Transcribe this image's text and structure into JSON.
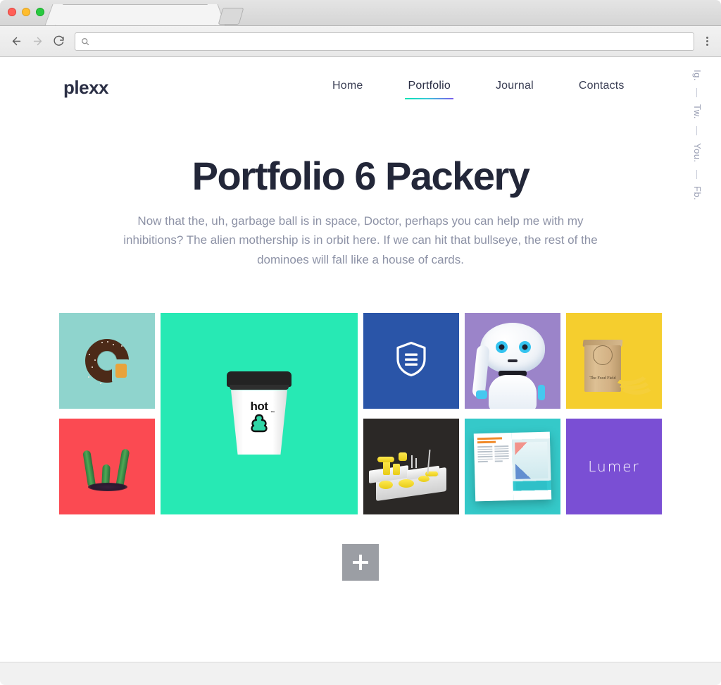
{
  "browser": {
    "tab_title": "",
    "url_value": "",
    "url_placeholder": "",
    "back_label": "Back",
    "forward_label": "Forward",
    "reload_label": "Reload",
    "menu_label": "Customize and control",
    "search_icon": "search-icon",
    "traffic_lights": [
      "close",
      "minimize",
      "maximize"
    ]
  },
  "site": {
    "logo": "plexx",
    "nav": [
      {
        "label": "Home",
        "active": false
      },
      {
        "label": "Portfolio",
        "active": true
      },
      {
        "label": "Journal",
        "active": false
      },
      {
        "label": "Contacts",
        "active": false
      }
    ],
    "social": [
      {
        "label": "Ig."
      },
      {
        "label": "—"
      },
      {
        "label": "Tw."
      },
      {
        "label": "—"
      },
      {
        "label": "You."
      },
      {
        "label": "—"
      },
      {
        "label": "Fb."
      }
    ]
  },
  "hero": {
    "title": "Portfolio 6 Packery",
    "subtitle": "Now that the, uh, garbage ball is in space, Doctor, perhaps you can help me with my inhibitions? The alien mothership is in orbit here. If we can hit that bullseye, the rest of the dominoes will fall like a house of cards."
  },
  "gallery": {
    "tiles": [
      {
        "id": "donut-c",
        "alt": "Chocolate donut letter C",
        "bg": "#8fd4cd",
        "size": "small"
      },
      {
        "id": "cactus-w",
        "alt": "Cactus letter W",
        "bg": "#fb4a52",
        "size": "small"
      },
      {
        "id": "hot-cup",
        "alt": "Hot coffee cup branding",
        "bg": "#27e9b4",
        "size": "large",
        "caption": "hot"
      },
      {
        "id": "shield",
        "alt": "Security shield icon",
        "bg": "#2a55a8",
        "size": "small"
      },
      {
        "id": "robot",
        "alt": "White humanoid robot",
        "bg": "#9b84c9",
        "size": "small"
      },
      {
        "id": "paper-bag",
        "alt": "Kraft paper bag and bananas",
        "bg": "#f5ce2e",
        "size": "small",
        "caption": "The Food Field"
      },
      {
        "id": "model-3d",
        "alt": "Yellow and white 3D model",
        "bg": "#2b2826",
        "size": "small"
      },
      {
        "id": "magazine",
        "alt": "Open magazine spread",
        "bg": "#35c9c9",
        "size": "small"
      },
      {
        "id": "lumer",
        "alt": "Lumer wordmark",
        "bg": "#7a4fd4",
        "size": "small",
        "caption": "Lumer"
      }
    ],
    "load_more_label": "+"
  },
  "colors": {
    "ink": "#232739",
    "muted": "#8d92a6",
    "accent_start": "#06e2b3",
    "accent_end": "#7b5ced",
    "load_more_bg": "#9b9ea4"
  }
}
